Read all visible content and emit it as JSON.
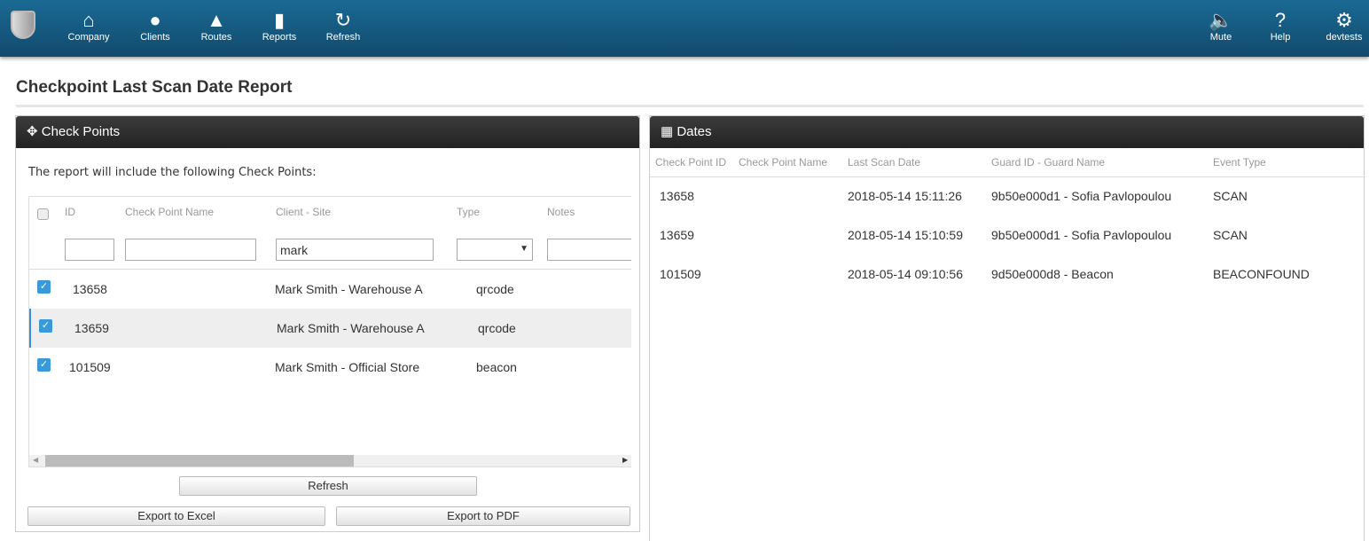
{
  "nav": {
    "left": [
      {
        "label": "Company",
        "icon": "home-icon",
        "glyph": "⌂"
      },
      {
        "label": "Clients",
        "icon": "user-icon",
        "glyph": "●"
      },
      {
        "label": "Routes",
        "icon": "road-icon",
        "glyph": "▲"
      },
      {
        "label": "Reports",
        "icon": "chart-icon",
        "glyph": "▮"
      },
      {
        "label": "Refresh",
        "icon": "refresh-icon",
        "glyph": "↻"
      }
    ],
    "right": [
      {
        "label": "Mute",
        "icon": "volume-icon",
        "glyph": "🔈"
      },
      {
        "label": "Help",
        "icon": "help-icon",
        "glyph": "?"
      },
      {
        "label": "devtests",
        "icon": "gear-icon",
        "glyph": "⚙"
      }
    ]
  },
  "page_title": "Checkpoint Last Scan Date Report",
  "checkpoints": {
    "title": "Check Points",
    "intro": "The report will include the following Check Points:",
    "columns": [
      "ID",
      "Check Point Name",
      "Client - Site",
      "Type",
      "Notes"
    ],
    "filters": {
      "id": "",
      "name": "",
      "client": "mark",
      "type": "",
      "notes": ""
    },
    "rows": [
      {
        "id": "13658",
        "name": "",
        "client": "Mark Smith - Warehouse A",
        "type": "qrcode",
        "checked": true
      },
      {
        "id": "13659",
        "name": "",
        "client": "Mark Smith - Warehouse A",
        "type": "qrcode",
        "checked": true,
        "selected": true
      },
      {
        "id": "101509",
        "name": "",
        "client": "Mark Smith - Official Store",
        "type": "beacon",
        "checked": true
      }
    ],
    "buttons": {
      "refresh": "Refresh",
      "excel": "Export to Excel",
      "pdf": "Export to PDF"
    }
  },
  "dates": {
    "title": "Dates",
    "columns": [
      "Check Point ID",
      "Check Point Name",
      "Last Scan Date",
      "Guard ID - Guard Name",
      "Event Type"
    ],
    "rows": [
      [
        "13658",
        "",
        "2018-05-14 15:11:26",
        "9b50e000d1 - Sofia Pavlopoulou",
        "SCAN"
      ],
      [
        "13659",
        "",
        "2018-05-14 15:10:59",
        "9b50e000d1 - Sofia Pavlopoulou",
        "SCAN"
      ],
      [
        "101509",
        "",
        "2018-05-14 09:10:56",
        "9d50e000d8 - Beacon",
        "BEACONFOUND"
      ]
    ]
  }
}
